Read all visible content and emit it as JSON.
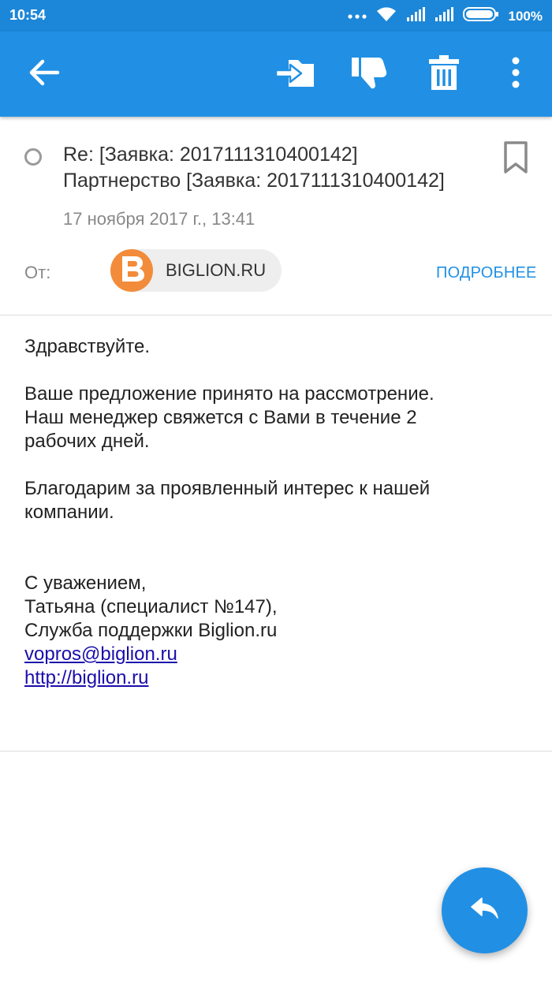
{
  "status_bar": {
    "time": "10:54",
    "battery_text": "100%"
  },
  "app_bar": {
    "color": "#2190e4",
    "icons": [
      "back-arrow-icon",
      "move-to-folder-icon",
      "thumbs-down-icon",
      "trash-icon",
      "more-vert-icon"
    ]
  },
  "email": {
    "subject_line1": "Re: [Заявка: 2017111310400142]",
    "subject_line2": "Партнерство [Заявка: 2017111310400142]",
    "date": "17 ноября 2017 г., 13:41",
    "from_label": "От:",
    "sender_name": "BIGLION.RU",
    "sender_avatar_letter": "B",
    "sender_avatar_color": "#f28c3a",
    "details_label": "ПОДРОБНЕЕ"
  },
  "body": {
    "greeting": "Здравствуйте.",
    "para1_line1": "Ваше предложение принято на рассмотрение.",
    "para1_line2": "Наш менеджер свяжется с Вами в течение 2",
    "para1_line3": "рабочих дней.",
    "para2_line1": "Благодарим за проявленный интерес к нашей",
    "para2_line2": "компании.",
    "sign_line1": "С уважением,",
    "sign_line2": "Татьяна (специалист №147),",
    "sign_line3": "Служба поддержки Biglion.ru",
    "email_link": "vopros@biglion.ru",
    "site_link": "http://biglion.ru"
  }
}
